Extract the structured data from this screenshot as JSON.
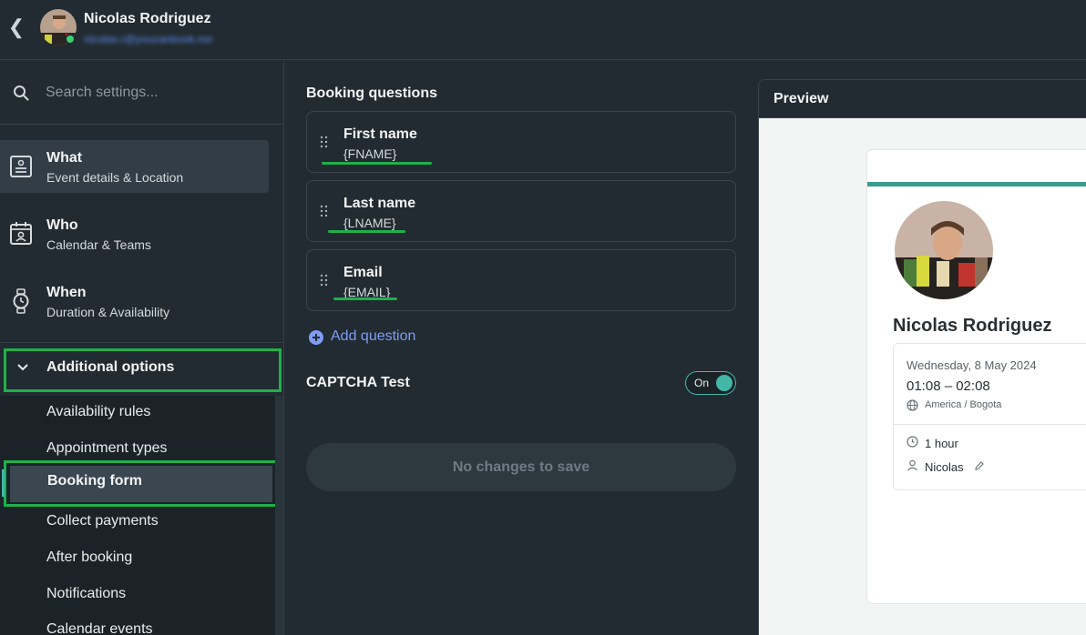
{
  "header": {
    "user_name": "Nicolas Rodriguez",
    "user_email": "nicolas.r@youcanbook.me"
  },
  "sidebar": {
    "search_placeholder": "Search settings...",
    "items": [
      {
        "title": "What",
        "subtitle": "Event details & Location",
        "icon": "event-details-icon"
      },
      {
        "title": "Who",
        "subtitle": "Calendar & Teams",
        "icon": "calendar-user-icon"
      },
      {
        "title": "When",
        "subtitle": "Duration & Availability",
        "icon": "watch-icon"
      }
    ],
    "additional_label": "Additional options",
    "sub_items": [
      "Availability rules",
      "Appointment types",
      "Booking form",
      "Collect payments",
      "After booking",
      "Notifications",
      "Calendar events"
    ]
  },
  "main": {
    "title": "Booking questions",
    "questions": [
      {
        "title": "First name",
        "tag": "{FNAME}"
      },
      {
        "title": "Last name",
        "tag": "{LNAME}"
      },
      {
        "title": "Email",
        "tag": "{EMAIL}"
      }
    ],
    "add_question": "Add question",
    "captcha_label": "CAPTCHA Test",
    "captcha_toggle": "On",
    "save_label": "No changes to save"
  },
  "preview": {
    "title": "Preview",
    "name": "Nicolas Rodriguez",
    "date": "Wednesday, 8 May 2024",
    "time": "01:08 – 02:08",
    "timezone": "America / Bogota",
    "duration": "1 hour",
    "host": "Nicolas"
  },
  "colors": {
    "accent_teal": "#42b7a8",
    "highlight_green": "#1fb04a",
    "link_blue": "#7f9cf5"
  }
}
